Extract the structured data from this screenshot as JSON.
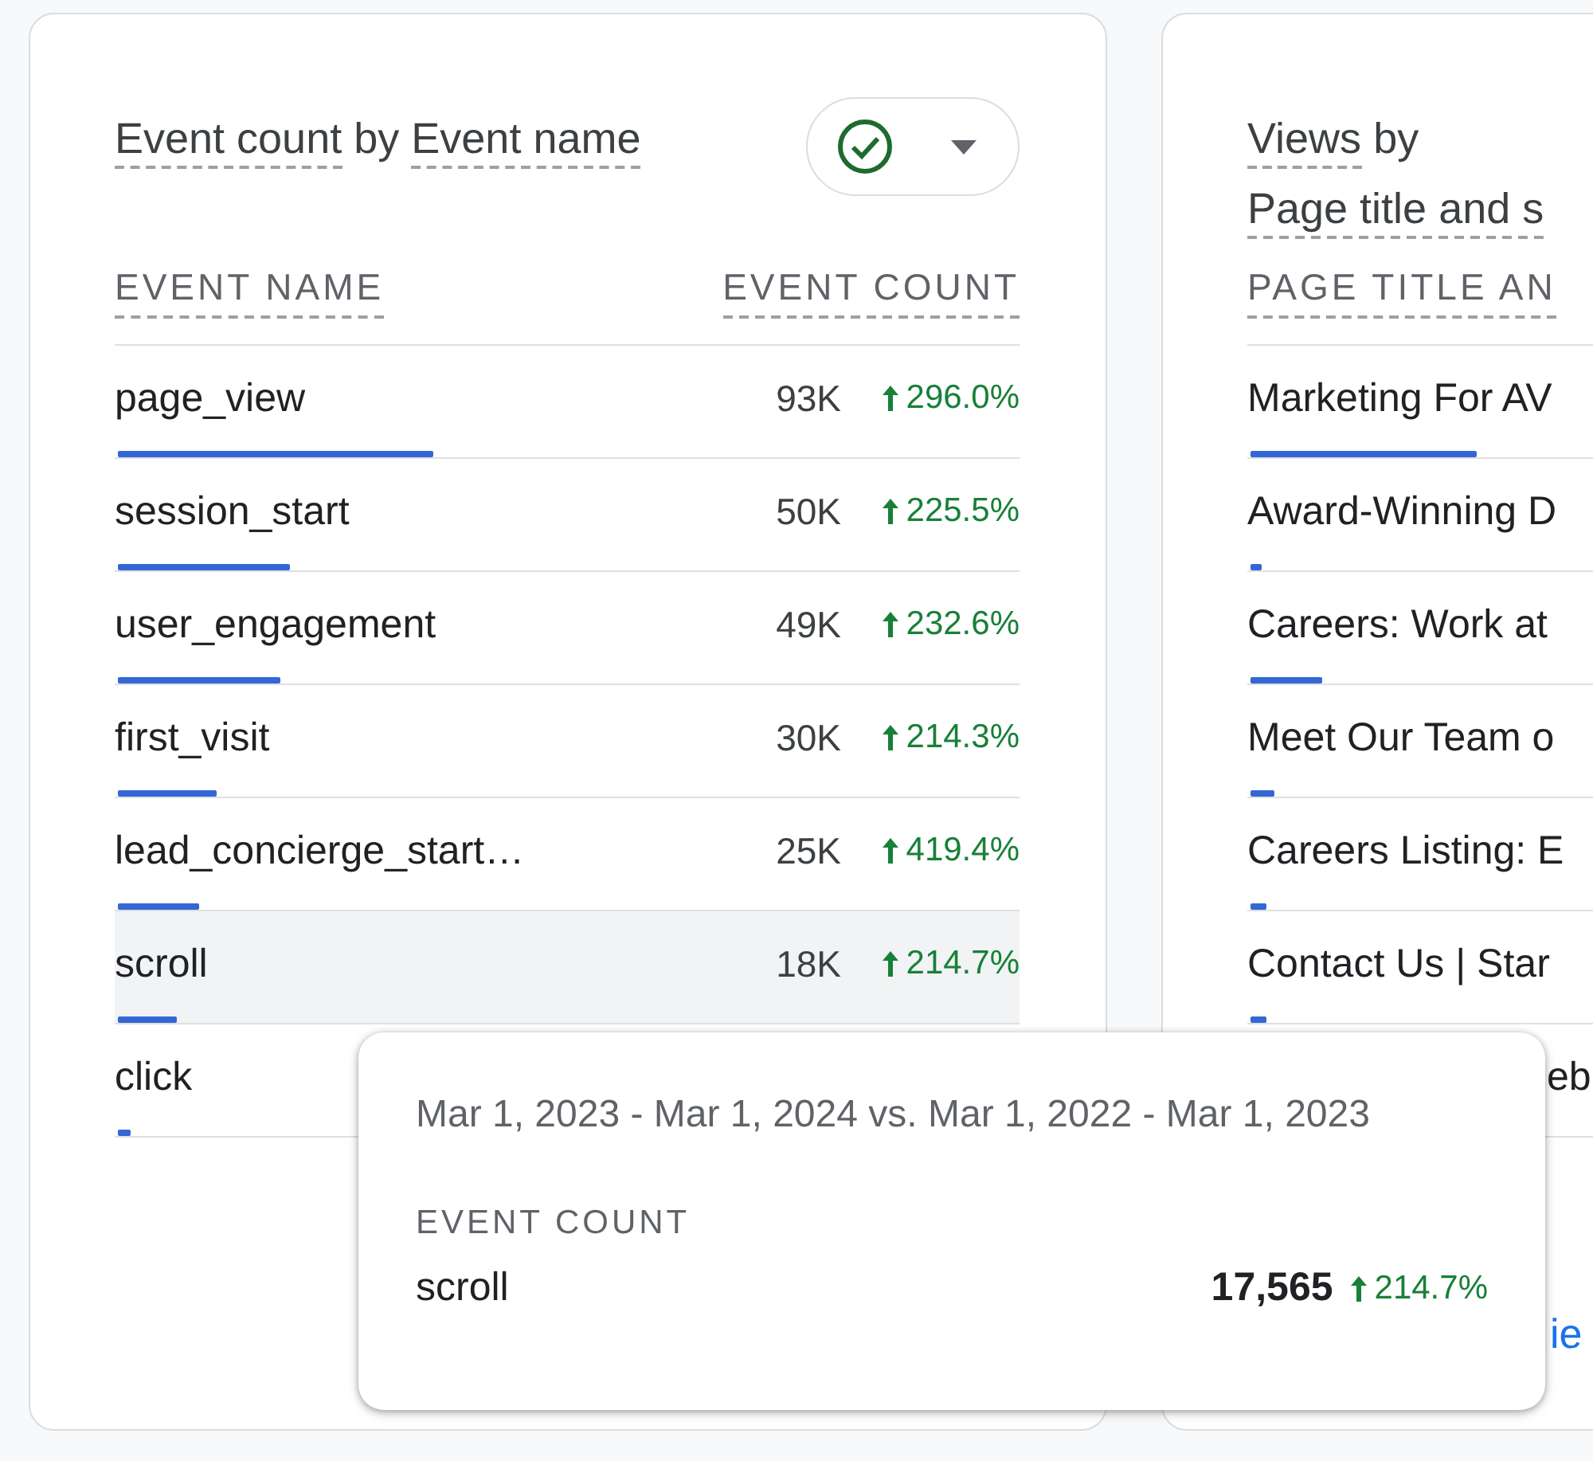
{
  "cards": [
    {
      "title": {
        "metric": "Event count",
        "joiner": "by",
        "dimension": "Event name"
      },
      "has_compare_button": true,
      "columns": [
        "EVENT NAME",
        "EVENT COUNT"
      ],
      "rows": [
        {
          "label": "page_view",
          "value": "93K",
          "change": "296.0%",
          "level": 0.35,
          "selected": false
        },
        {
          "label": "session_start",
          "value": "50K",
          "change": "225.5%",
          "level": 0.19,
          "selected": false
        },
        {
          "label": "user_engagement",
          "value": "49K",
          "change": "232.6%",
          "level": 0.18,
          "selected": false
        },
        {
          "label": "first_visit",
          "value": "30K",
          "change": "214.3%",
          "level": 0.11,
          "selected": false
        },
        {
          "label": "lead_concierge_start…",
          "value": "25K",
          "change": "419.4%",
          "level": 0.09,
          "selected": false
        },
        {
          "label": "scroll",
          "value": "18K",
          "change": "214.7%",
          "level": 0.065,
          "selected": true
        },
        {
          "label": "click",
          "level": 0.014,
          "selected": false
        }
      ]
    },
    {
      "title": {
        "metric": "Views",
        "joiner": "by",
        "dimension": "Page title and s"
      },
      "columns": [
        "PAGE TITLE AN"
      ],
      "rows": [
        {
          "label": "Marketing For AV",
          "level": 0.25,
          "selected": false
        },
        {
          "label": "Award-Winning D",
          "level": 0.004,
          "selected": false
        },
        {
          "label": "Careers: Work at",
          "level": 0.08,
          "selected": false
        },
        {
          "label": "Meet Our Team o",
          "level": 0.026,
          "selected": false
        },
        {
          "label": "Careers Listing: E",
          "level": 0.018,
          "selected": false
        },
        {
          "label": "Contact Us | Star",
          "level": 0.018,
          "selected": false
        },
        {
          "label": "eb",
          "kind": "partial",
          "selected": false
        }
      ],
      "link": "ie"
    }
  ],
  "tooltip": {
    "date_range": "Mar 1, 2023 - Mar 1, 2024 vs. Mar 1, 2022 - Mar 1, 2023",
    "metric": "EVENT COUNT",
    "label": "scroll",
    "value": "17,565",
    "change": "214.7%"
  }
}
